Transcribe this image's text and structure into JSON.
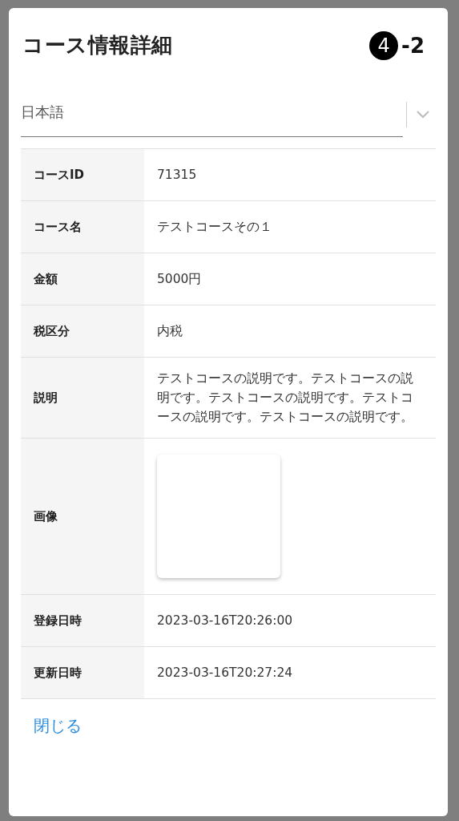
{
  "dialog": {
    "title": "コース情報詳細",
    "step_number": "4",
    "step_suffix": "-2"
  },
  "language_select": {
    "value": "日本語"
  },
  "table": {
    "rows": [
      {
        "kind": "text",
        "label": "コースID",
        "value": "71315"
      },
      {
        "kind": "text",
        "label": "コース名",
        "value": "テストコースその１"
      },
      {
        "kind": "text",
        "label": "金額",
        "value": "5000円"
      },
      {
        "kind": "text",
        "label": "税区分",
        "value": "内税"
      },
      {
        "kind": "text",
        "label": "説明",
        "value": "テストコースの説明です。テストコースの説明です。テストコースの説明です。テストコースの説明です。テストコースの説明です。"
      },
      {
        "kind": "image",
        "label": "画像"
      },
      {
        "kind": "text",
        "label": "登録日時",
        "value": "2023-03-16T20:26:00"
      },
      {
        "kind": "text",
        "label": "更新日時",
        "value": "2023-03-16T20:27:24"
      }
    ]
  },
  "actions": [
    {
      "label": "閉じる"
    }
  ]
}
